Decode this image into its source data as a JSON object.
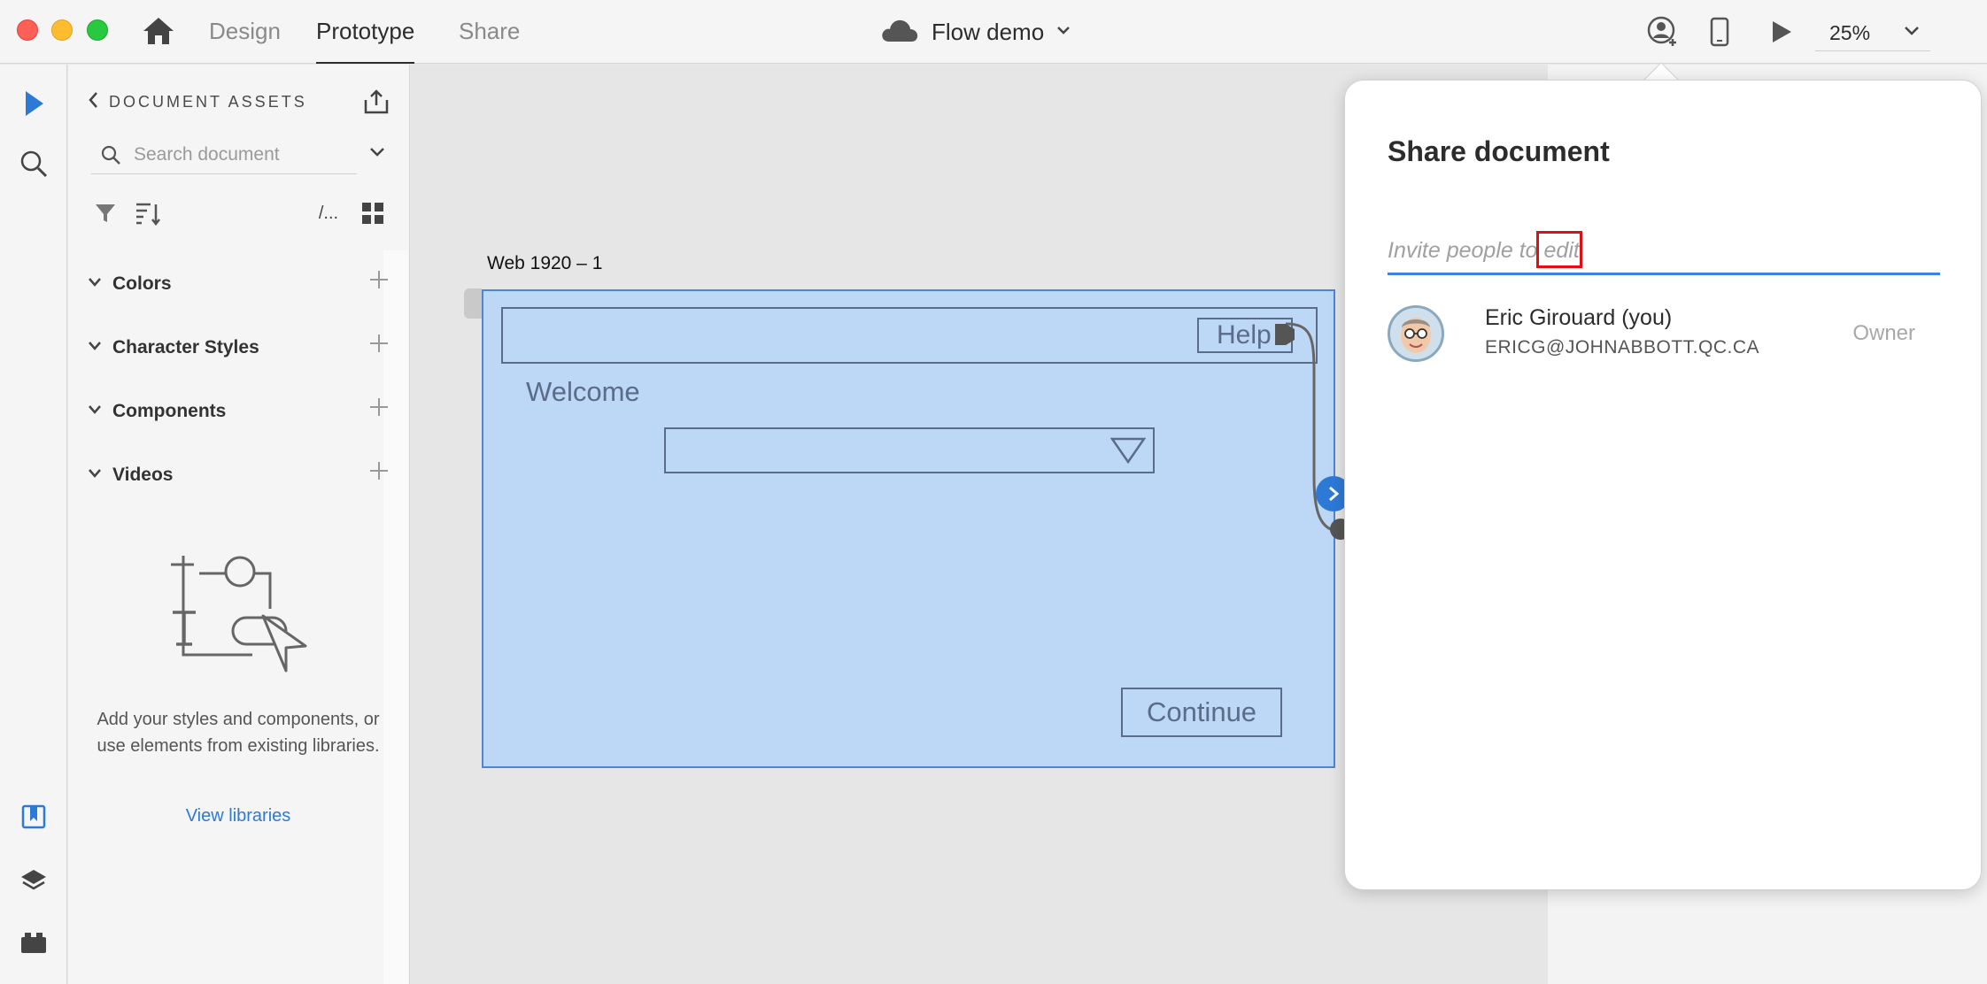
{
  "titlebar": {
    "tabs": [
      {
        "label": "Design",
        "active": false
      },
      {
        "label": "Prototype",
        "active": true
      },
      {
        "label": "Share",
        "active": false
      }
    ],
    "document_name": "Flow demo",
    "zoom": "25%",
    "icons": [
      "home-icon",
      "cloud-icon",
      "invite-user-icon",
      "mobile-preview-icon",
      "play-icon",
      "chevron-down-icon"
    ]
  },
  "rail": {
    "icons": [
      "select-tool-icon",
      "zoom-search-icon",
      "assets-icon",
      "layers-icon",
      "plugins-icon"
    ],
    "accent_color": "#2d7ad6"
  },
  "assets": {
    "header": "DOCUMENT ASSETS",
    "search_placeholder": "Search document",
    "view_toggle_label": "/...",
    "sections": [
      {
        "label": "Colors"
      },
      {
        "label": "Character Styles"
      },
      {
        "label": "Components"
      },
      {
        "label": "Videos"
      }
    ],
    "empty_text": "Add your styles and components, or use elements from existing libraries.",
    "view_libraries": "View libraries"
  },
  "canvas": {
    "artboard_name": "Web 1920 – 1",
    "artboard_fill": "#bdd7f6",
    "wireframe": {
      "help_label": "Help",
      "welcome_label": "Welcome",
      "continue_label": "Continue"
    }
  },
  "share": {
    "title": "Share document",
    "invite_placeholder": "Invite people to edit",
    "highlighted_word": "edit",
    "users": [
      {
        "name": "Eric Girouard (you)",
        "email": "ERICG@JOHNABBOTT.QC.CA",
        "role": "Owner"
      }
    ]
  }
}
